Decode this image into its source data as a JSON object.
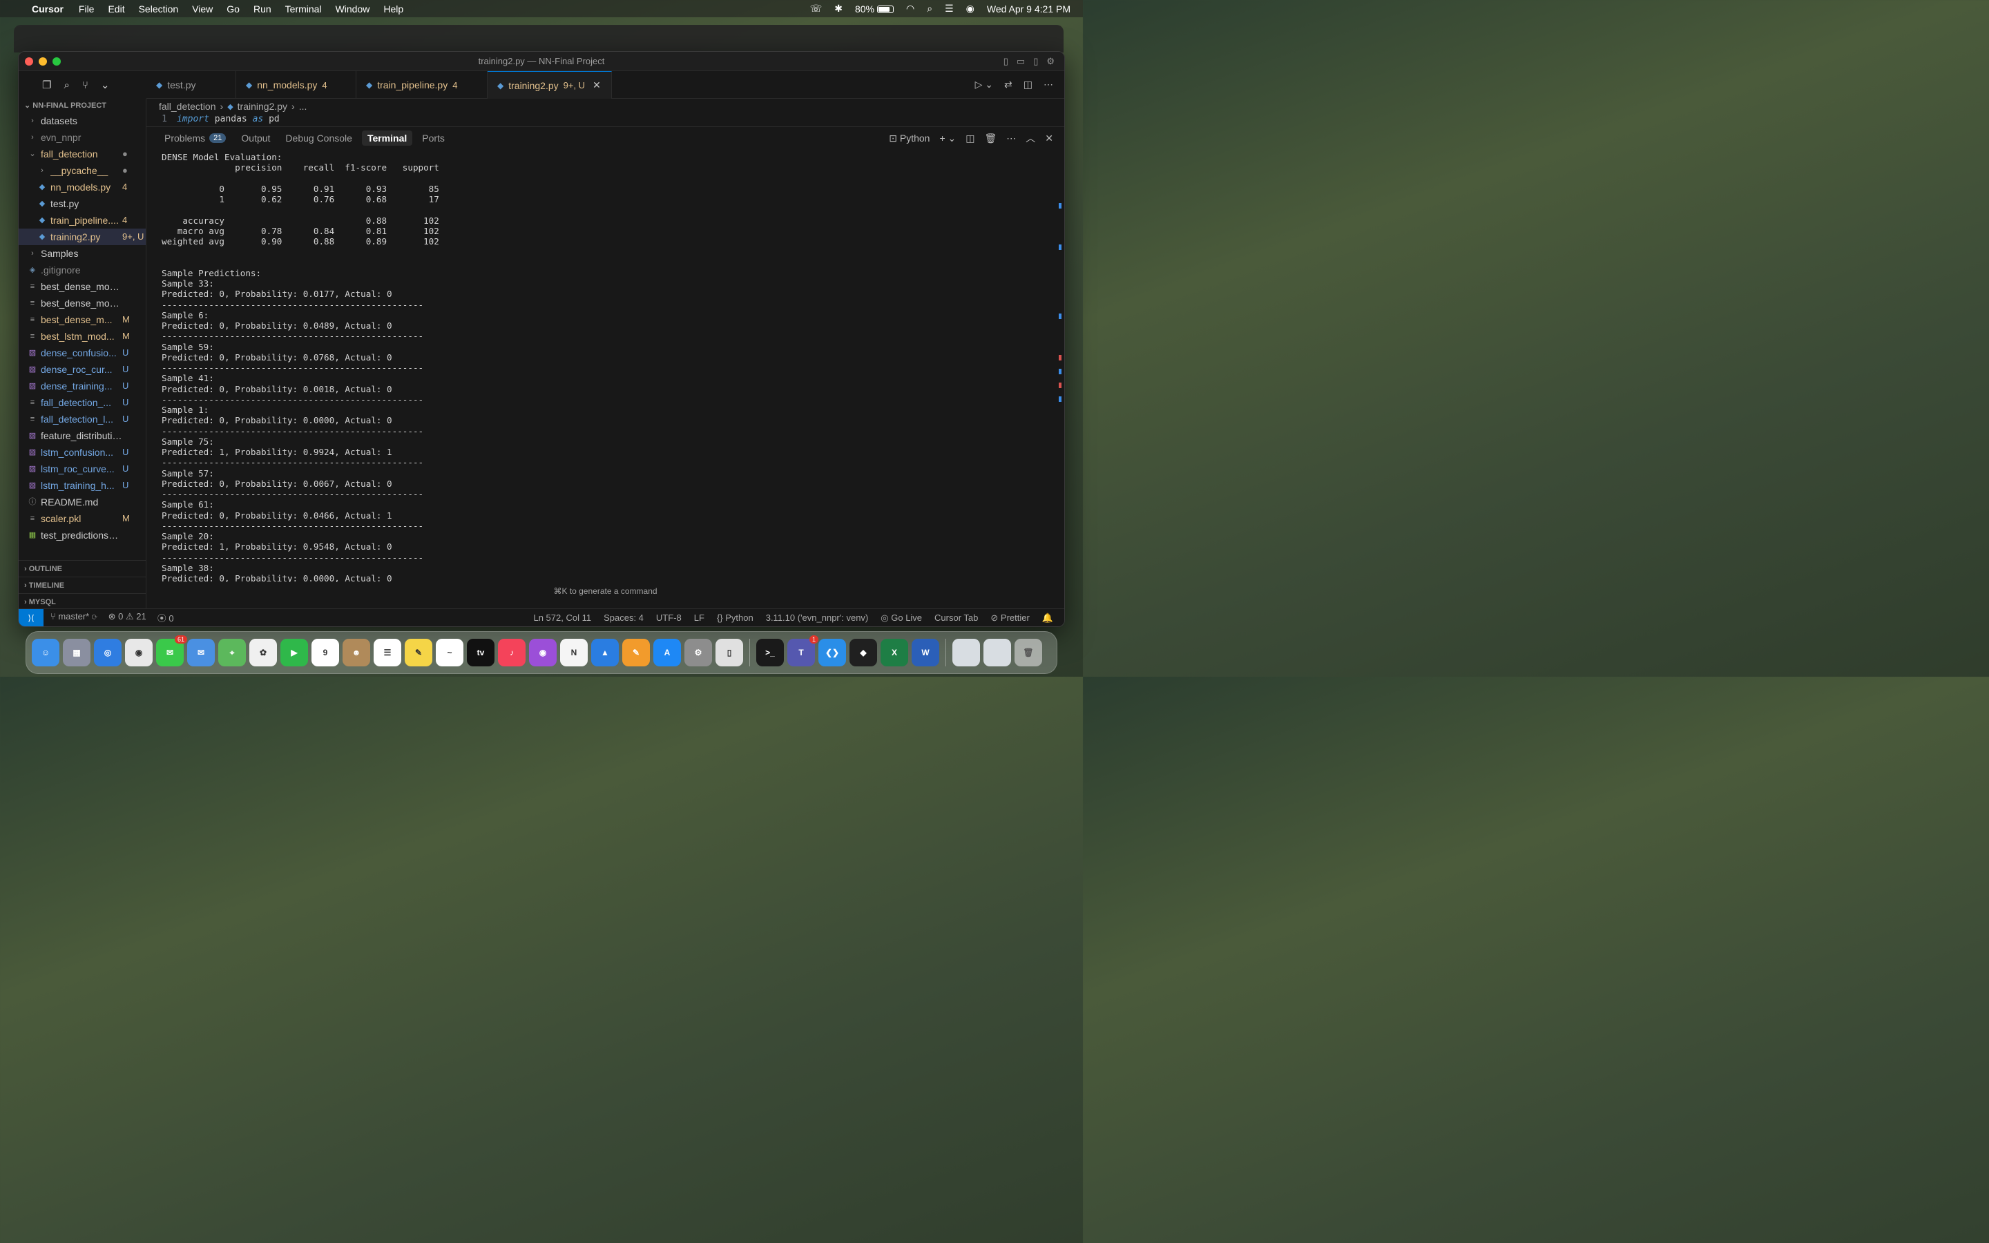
{
  "menubar": {
    "app": "Cursor",
    "items": [
      "File",
      "Edit",
      "Selection",
      "View",
      "Go",
      "Run",
      "Terminal",
      "Window",
      "Help"
    ],
    "battery": "80%",
    "datetime": "Wed Apr 9  4:21 PM"
  },
  "window": {
    "title": "training2.py — NN-Final Project"
  },
  "sidebar": {
    "project": "NN-FINAL PROJECT",
    "items": [
      {
        "name": "datasets",
        "badge": "",
        "kind": "folder"
      },
      {
        "name": "evn_nnpr",
        "badge": "",
        "kind": "folder"
      },
      {
        "name": "fall_detection",
        "badge": "●",
        "kind": "folder-open"
      },
      {
        "name": "__pycache__",
        "badge": "●",
        "kind": "folder"
      },
      {
        "name": "nn_models.py",
        "badge": "4",
        "kind": "py"
      },
      {
        "name": "test.py",
        "badge": "",
        "kind": "py"
      },
      {
        "name": "train_pipeline....",
        "badge": "4",
        "kind": "py"
      },
      {
        "name": "training2.py",
        "badge": "9+, U",
        "kind": "py"
      },
      {
        "name": "Samples",
        "badge": "",
        "kind": "folder"
      },
      {
        "name": ".gitignore",
        "badge": "",
        "kind": "git"
      },
      {
        "name": "best_dense_model_...",
        "badge": "",
        "kind": "file"
      },
      {
        "name": "best_dense_model_...",
        "badge": "",
        "kind": "file"
      },
      {
        "name": "best_dense_m...",
        "badge": "M",
        "kind": "file"
      },
      {
        "name": "best_lstm_mod...",
        "badge": "M",
        "kind": "file"
      },
      {
        "name": "dense_confusio...",
        "badge": "U",
        "kind": "img"
      },
      {
        "name": "dense_roc_cur...",
        "badge": "U",
        "kind": "img"
      },
      {
        "name": "dense_training...",
        "badge": "U",
        "kind": "img"
      },
      {
        "name": "fall_detection_...",
        "badge": "U",
        "kind": "file"
      },
      {
        "name": "fall_detection_l...",
        "badge": "U",
        "kind": "file"
      },
      {
        "name": "feature_distributions...",
        "badge": "",
        "kind": "img"
      },
      {
        "name": "lstm_confusion...",
        "badge": "U",
        "kind": "img"
      },
      {
        "name": "lstm_roc_curve...",
        "badge": "U",
        "kind": "img"
      },
      {
        "name": "lstm_training_h...",
        "badge": "U",
        "kind": "img"
      },
      {
        "name": "README.md",
        "badge": "",
        "kind": "info"
      },
      {
        "name": "scaler.pkl",
        "badge": "M",
        "kind": "file"
      },
      {
        "name": "test_predictions_rea...",
        "badge": "",
        "kind": "csv"
      }
    ],
    "sections": [
      "OUTLINE",
      "TIMELINE",
      "MYSQL"
    ]
  },
  "tabs": [
    {
      "label": "test.py",
      "count": ""
    },
    {
      "label": "nn_models.py",
      "count": "4"
    },
    {
      "label": "train_pipeline.py",
      "count": "4"
    },
    {
      "label": "training2.py",
      "count": "9+, U"
    }
  ],
  "breadcrumb": {
    "folder": "fall_detection",
    "file": "training2.py",
    "more": "..."
  },
  "code": {
    "line_no": "1",
    "kw1": "import",
    "mod": " pandas ",
    "kw2": "as",
    "alias": " pd"
  },
  "panel": {
    "tabs": [
      "Problems",
      "Output",
      "Debug Console",
      "Terminal",
      "Ports"
    ],
    "problems_count": "21",
    "shell": "Python",
    "hint": "⌘K to generate a command"
  },
  "terminal": {
    "lines": [
      "DENSE Model Evaluation:",
      "              precision    recall  f1-score   support",
      "",
      "           0       0.95      0.91      0.93        85",
      "           1       0.62      0.76      0.68        17",
      "",
      "    accuracy                           0.88       102",
      "   macro avg       0.78      0.84      0.81       102",
      "weighted avg       0.90      0.88      0.89       102",
      "",
      "",
      "Sample Predictions:",
      "Sample 33:",
      "Predicted: 0, Probability: 0.0177, Actual: 0",
      "--------------------------------------------------",
      "Sample 6:",
      "Predicted: 0, Probability: 0.0489, Actual: 0",
      "--------------------------------------------------",
      "Sample 59:",
      "Predicted: 0, Probability: 0.0768, Actual: 0",
      "--------------------------------------------------",
      "Sample 41:",
      "Predicted: 0, Probability: 0.0018, Actual: 0",
      "--------------------------------------------------",
      "Sample 1:",
      "Predicted: 0, Probability: 0.0000, Actual: 0",
      "--------------------------------------------------",
      "Sample 75:",
      "Predicted: 1, Probability: 0.9924, Actual: 1",
      "--------------------------------------------------",
      "Sample 57:",
      "Predicted: 0, Probability: 0.0067, Actual: 0",
      "--------------------------------------------------",
      "Sample 61:",
      "Predicted: 0, Probability: 0.0466, Actual: 1",
      "--------------------------------------------------",
      "Sample 20:",
      "Predicted: 1, Probability: 0.9548, Actual: 0",
      "--------------------------------------------------",
      "Sample 38:",
      "Predicted: 0, Probability: 0.0000, Actual: 0",
      "--------------------------------------------------"
    ]
  },
  "statusbar": {
    "branch": "master*",
    "errors": "0",
    "warnings": "21",
    "ports": "0",
    "position": "Ln 572, Col 11",
    "spaces": "Spaces: 4",
    "encoding": "UTF-8",
    "eol": "LF",
    "language": "Python",
    "interpreter": "3.11.10 ('evn_nnpr': venv)",
    "golive": "Go Live",
    "cursortab": "Cursor Tab",
    "prettier": "Prettier"
  },
  "dock": {
    "apps": [
      {
        "name": "Finder",
        "color": "#3b8fe8",
        "glyph": "☺",
        "badge": ""
      },
      {
        "name": "Launchpad",
        "color": "#8a8fa0",
        "glyph": "▦",
        "badge": ""
      },
      {
        "name": "Safari",
        "color": "#2f7de1",
        "glyph": "◎",
        "badge": ""
      },
      {
        "name": "Chrome",
        "color": "#e8e8e8",
        "glyph": "◉",
        "badge": ""
      },
      {
        "name": "Messages",
        "color": "#3ac94a",
        "glyph": "✉",
        "badge": "61"
      },
      {
        "name": "Mail",
        "color": "#4a90e2",
        "glyph": "✉",
        "badge": ""
      },
      {
        "name": "Maps",
        "color": "#5cb85c",
        "glyph": "⌖",
        "badge": ""
      },
      {
        "name": "Photos",
        "color": "#f0f0f0",
        "glyph": "✿",
        "badge": ""
      },
      {
        "name": "FaceTime",
        "color": "#2fb84a",
        "glyph": "▶",
        "badge": ""
      },
      {
        "name": "Calendar",
        "color": "#ffffff",
        "glyph": "9",
        "badge": ""
      },
      {
        "name": "Contacts",
        "color": "#b08a5a",
        "glyph": "☻",
        "badge": ""
      },
      {
        "name": "Reminders",
        "color": "#ffffff",
        "glyph": "☰",
        "badge": ""
      },
      {
        "name": "Notes",
        "color": "#f5d547",
        "glyph": "✎",
        "badge": ""
      },
      {
        "name": "Freeform",
        "color": "#ffffff",
        "glyph": "~",
        "badge": ""
      },
      {
        "name": "TV",
        "color": "#111111",
        "glyph": "tv",
        "badge": ""
      },
      {
        "name": "Music",
        "color": "#f4435a",
        "glyph": "♪",
        "badge": ""
      },
      {
        "name": "Podcasts",
        "color": "#9b4fd8",
        "glyph": "◉",
        "badge": ""
      },
      {
        "name": "News",
        "color": "#f5f5f5",
        "glyph": "N",
        "badge": ""
      },
      {
        "name": "Keynote",
        "color": "#2a7de1",
        "glyph": "▲",
        "badge": ""
      },
      {
        "name": "Pages",
        "color": "#f29b2c",
        "glyph": "✎",
        "badge": ""
      },
      {
        "name": "App Store",
        "color": "#1e88f5",
        "glyph": "A",
        "badge": ""
      },
      {
        "name": "System Settings",
        "color": "#8d8d8d",
        "glyph": "⚙",
        "badge": ""
      },
      {
        "name": "iPhone Mirroring",
        "color": "#e0e0e0",
        "glyph": "▯",
        "badge": ""
      },
      {
        "name": "Terminal",
        "color": "#1a1a1a",
        "glyph": ">_",
        "badge": ""
      },
      {
        "name": "Teams",
        "color": "#5558af",
        "glyph": "T",
        "badge": "1"
      },
      {
        "name": "VS Code",
        "color": "#2a8ee8",
        "glyph": "❮❯",
        "badge": ""
      },
      {
        "name": "Cursor",
        "color": "#202020",
        "glyph": "◆",
        "badge": ""
      },
      {
        "name": "Excel",
        "color": "#1e7e45",
        "glyph": "X",
        "badge": ""
      },
      {
        "name": "Word",
        "color": "#2b5fb8",
        "glyph": "W",
        "badge": ""
      }
    ]
  }
}
